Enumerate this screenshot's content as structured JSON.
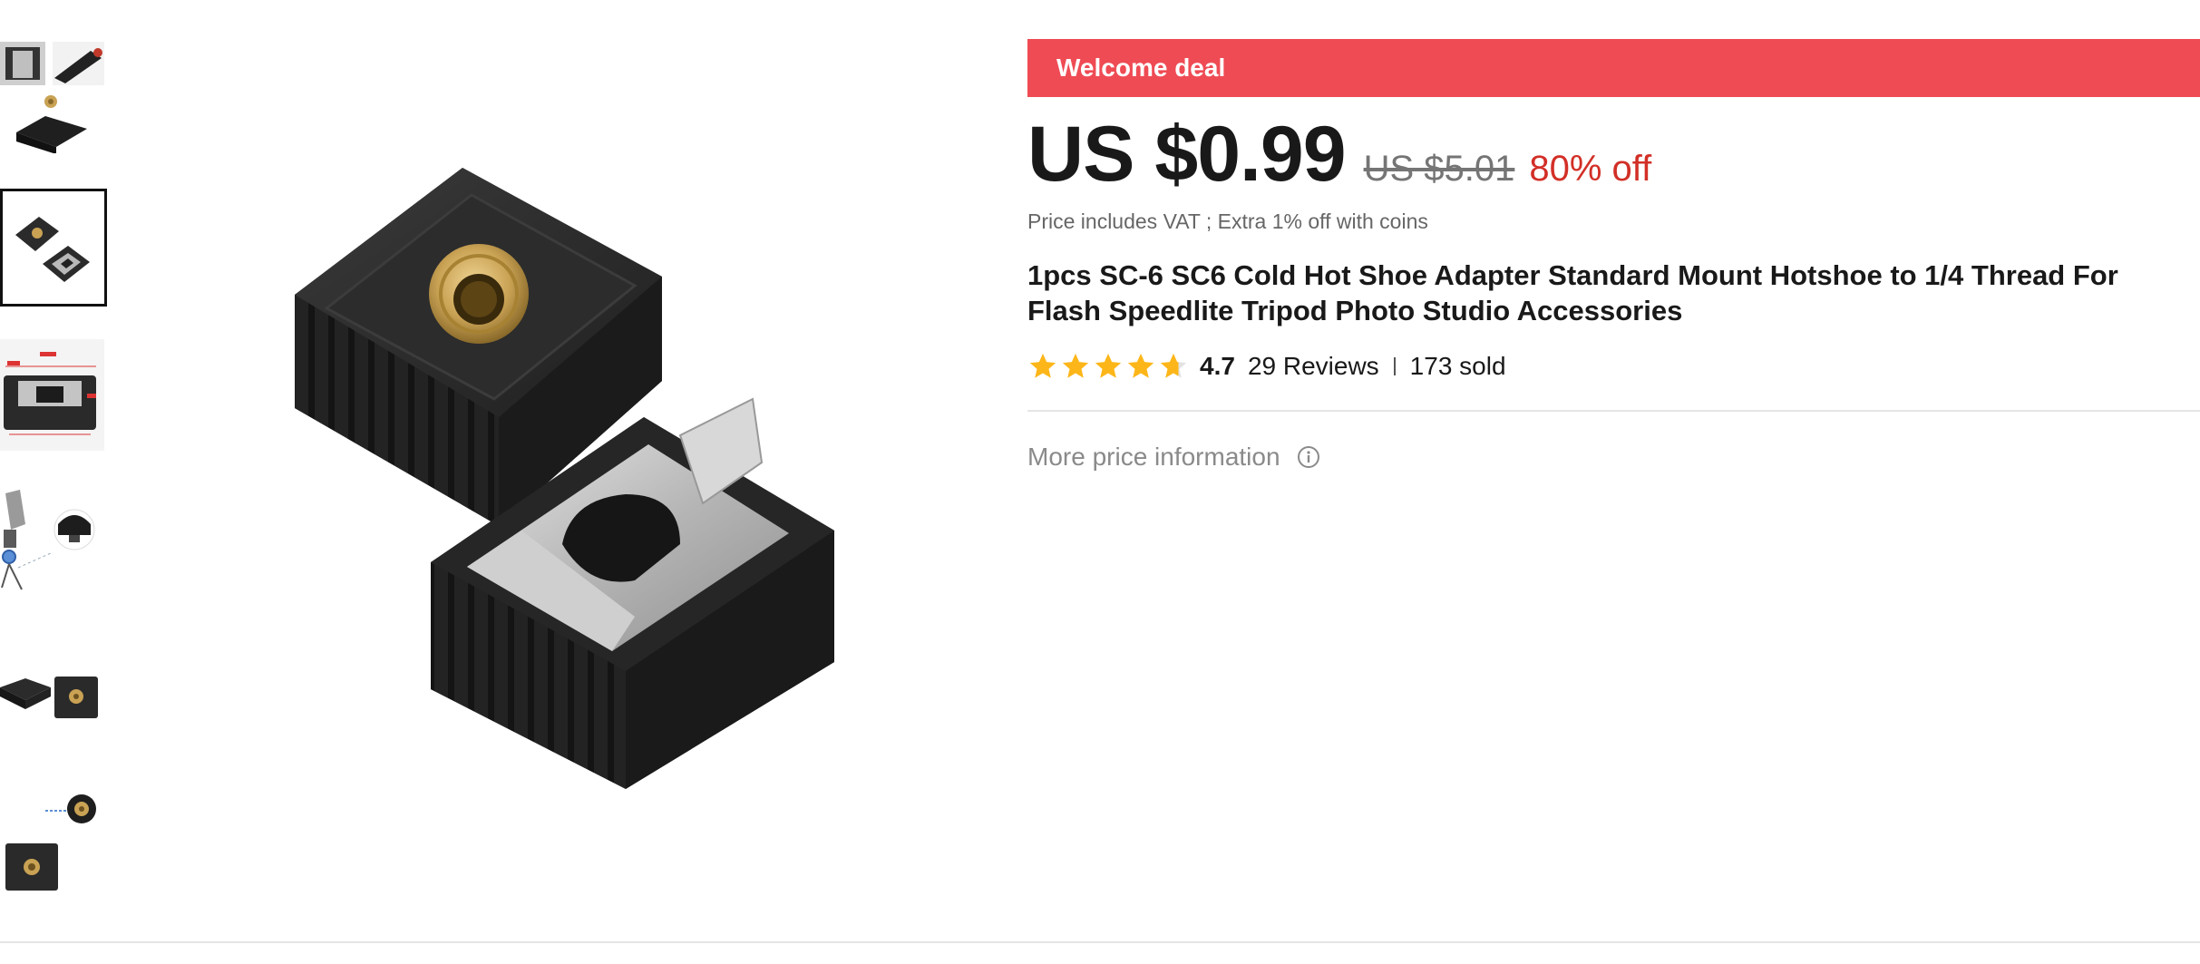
{
  "deal": {
    "label": "Welcome deal"
  },
  "price": {
    "current": "US $0.99",
    "original": "US $5.01",
    "discount": "80% off",
    "vat_note": "Price includes VAT ; Extra 1% off with coins"
  },
  "product": {
    "title": "1pcs SC-6 SC6 Cold Hot Shoe Adapter Standard Mount Hotshoe to 1/4 Thread For Flash Speedlite Tripod Photo Studio Accessories"
  },
  "rating": {
    "value": "4.7",
    "stars": 4.7,
    "reviews": "29 Reviews",
    "separator": "I",
    "sold": "173 sold"
  },
  "more_price_info": {
    "label": "More price information",
    "icon": "info-icon"
  },
  "gallery": {
    "thumbnails": [
      "thumb-1",
      "thumb-2",
      "thumb-3",
      "thumb-4",
      "thumb-5",
      "thumb-6"
    ],
    "active_index": 1
  },
  "colors": {
    "deal_banner": "#ef4b54",
    "discount": "#d22f27",
    "star": "#fdb619"
  }
}
